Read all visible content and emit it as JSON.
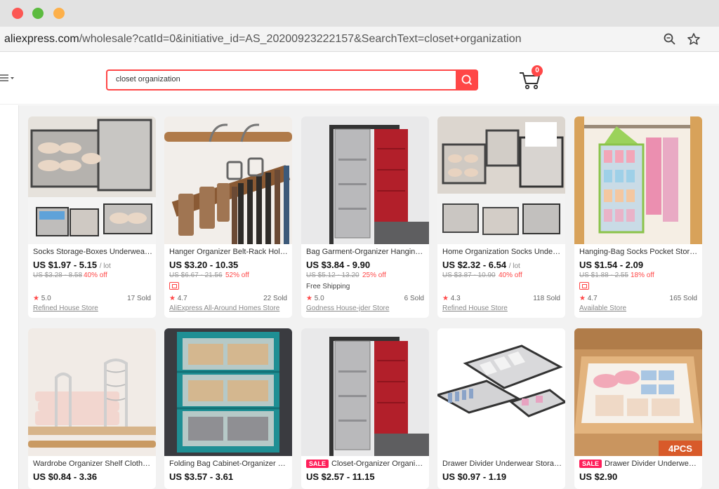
{
  "browser": {
    "url_host": "aliexpress.com",
    "url_path": "/wholesale?catId=0&initiative_id=AS_20200923222157&SearchText=closet+organization"
  },
  "header": {
    "search_value": "closet organization",
    "cart_count": "0"
  },
  "products": [
    {
      "title": "Socks Storage-Boxes Underwear Organizer",
      "price": "US $1.97 - 5.15",
      "unit": "/ lot",
      "old_price": "US $3.28 - 8.58",
      "discount": "40% off",
      "rating": "5.0",
      "sold": "17 Sold",
      "store": "Refined House Store"
    },
    {
      "title": "Hanger Organizer Belt-Rack Holder",
      "price": "US $3.20 - 10.35",
      "unit": "",
      "old_price": "US $6.67 - 21.56",
      "discount": "52% off",
      "rating": "4.7",
      "sold": "22 Sold",
      "store": "AliExpress All-Around Homes Store"
    },
    {
      "title": "Bag Garment-Organizer Hanging-Bag",
      "price": "US $3.84 - 9.90",
      "unit": "",
      "old_price": "US $5.12 - 13.20",
      "discount": "25% off",
      "shipping": "Free Shipping",
      "rating": "5.0",
      "sold": "6 Sold",
      "store": "Godness House-jder Store"
    },
    {
      "title": "Home Organization Socks Underwear",
      "price": "US $2.32 - 6.54",
      "unit": "/ lot",
      "old_price": "US $3.87 - 10.90",
      "discount": "40% off",
      "rating": "4.3",
      "sold": "118 Sold",
      "store": "Refined House Store"
    },
    {
      "title": "Hanging-Bag Socks Pocket Storage-Bag",
      "price": "US $1.54 - 2.09",
      "unit": "",
      "old_price": "US $1.88 - 2.55",
      "discount": "18% off",
      "rating": "4.7",
      "sold": "165 Sold",
      "store": "Available Store"
    },
    {
      "title": "Wardrobe Organizer Shelf Clothes-Divider",
      "price": "US $0.84 - 3.36",
      "sale": ""
    },
    {
      "title": "Folding Bag Cabinet-Organizer Storage",
      "price": "US $3.57 - 3.61",
      "sale": ""
    },
    {
      "title": "Closet-Organizer Organizer Hanging",
      "price": "US $2.57 - 11.15",
      "sale": "SALE"
    },
    {
      "title": "Drawer Divider Underwear Storage-Box",
      "price": "US $0.97 - 1.19",
      "sale": ""
    },
    {
      "title": "Drawer Divider Underwear Organizer",
      "price": "US $2.90",
      "sale": "SALE",
      "badge": "4PCS"
    }
  ]
}
